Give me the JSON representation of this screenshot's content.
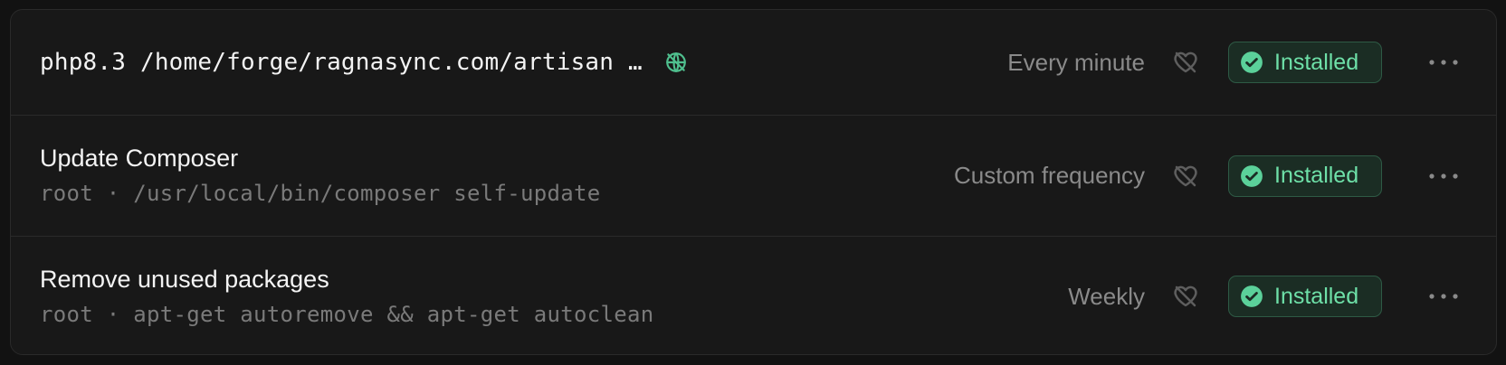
{
  "jobs": [
    {
      "command": "php8.3 /home/forge/ragnasync.com/artisan …",
      "frequency": "Every minute",
      "status": "Installed"
    },
    {
      "title": "Update Composer",
      "user": "root",
      "separator": "·",
      "command": "/usr/local/bin/composer self-update",
      "frequency": "Custom frequency",
      "status": "Installed"
    },
    {
      "title": "Remove unused packages",
      "user": "root",
      "separator": "·",
      "command": "apt-get autoremove && apt-get autoclean",
      "frequency": "Weekly",
      "status": "Installed"
    }
  ],
  "colors": {
    "accent_green": "#6ee0a8",
    "badge_bg": "#1b2d24",
    "badge_border": "#2e5a45",
    "muted": "#8a8a8a"
  },
  "icons": {
    "globe": "globe-off-icon",
    "heartbeat": "heart-off-icon",
    "status": "check-circle-icon",
    "menu": "more-horizontal-icon"
  }
}
